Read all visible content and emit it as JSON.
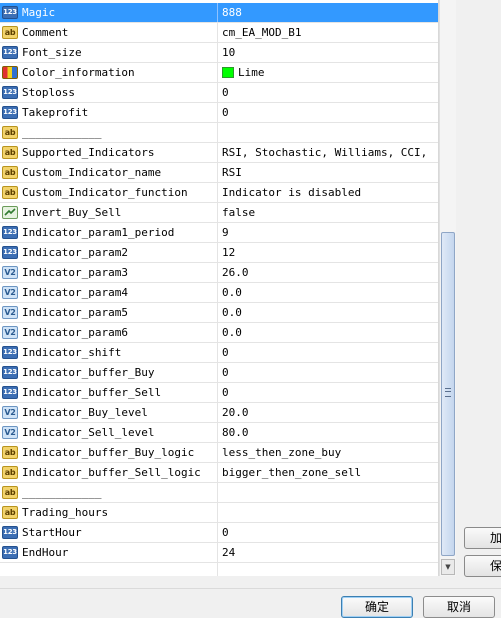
{
  "rows": [
    {
      "type": "int",
      "badge": "123",
      "name": "Magic",
      "value": "888"
    },
    {
      "type": "str",
      "badge": "ab",
      "name": "Comment",
      "value": "cm_EA_MOD_B1"
    },
    {
      "type": "int",
      "badge": "123",
      "name": "Font_size",
      "value": "10"
    },
    {
      "type": "color",
      "badge": "",
      "name": "Color_information",
      "value": "Lime"
    },
    {
      "type": "int",
      "badge": "123",
      "name": "Stoploss",
      "value": "0"
    },
    {
      "type": "int",
      "badge": "123",
      "name": "Takeprofit",
      "value": "0"
    },
    {
      "type": "str",
      "badge": "ab",
      "name": "____________",
      "value": ""
    },
    {
      "type": "str",
      "badge": "ab",
      "name": "Supported_Indicators",
      "value": "RSI, Stochastic, Williams, CCI, ..."
    },
    {
      "type": "str",
      "badge": "ab",
      "name": "Custom_Indicator_name",
      "value": "RSI"
    },
    {
      "type": "str",
      "badge": "ab",
      "name": "Custom_Indicator_function",
      "value": "Indicator is disabled"
    },
    {
      "type": "bool",
      "badge": "",
      "name": "Invert_Buy_Sell",
      "value": "false"
    },
    {
      "type": "int",
      "badge": "123",
      "name": "Indicator_param1_period",
      "value": "9"
    },
    {
      "type": "int",
      "badge": "123",
      "name": "Indicator_param2",
      "value": "12"
    },
    {
      "type": "dbl",
      "badge": "V2",
      "name": "Indicator_param3",
      "value": "26.0"
    },
    {
      "type": "dbl",
      "badge": "V2",
      "name": "Indicator_param4",
      "value": "0.0"
    },
    {
      "type": "dbl",
      "badge": "V2",
      "name": "Indicator_param5",
      "value": "0.0"
    },
    {
      "type": "dbl",
      "badge": "V2",
      "name": "Indicator_param6",
      "value": "0.0"
    },
    {
      "type": "int",
      "badge": "123",
      "name": "Indicator_shift",
      "value": "0"
    },
    {
      "type": "int",
      "badge": "123",
      "name": "Indicator_buffer_Buy",
      "value": "0"
    },
    {
      "type": "int",
      "badge": "123",
      "name": "Indicator_buffer_Sell",
      "value": "0"
    },
    {
      "type": "dbl",
      "badge": "V2",
      "name": "Indicator_Buy_level",
      "value": "20.0"
    },
    {
      "type": "dbl",
      "badge": "V2",
      "name": "Indicator_Sell_level",
      "value": "80.0"
    },
    {
      "type": "str",
      "badge": "ab",
      "name": "Indicator_buffer_Buy_logic",
      "value": "less_then_zone_buy"
    },
    {
      "type": "str",
      "badge": "ab",
      "name": "Indicator_buffer_Sell_logic",
      "value": "bigger_then_zone_sell"
    },
    {
      "type": "str",
      "badge": "ab",
      "name": "____________",
      "value": ""
    },
    {
      "type": "str",
      "badge": "ab",
      "name": "Trading_hours",
      "value": ""
    },
    {
      "type": "int",
      "badge": "123",
      "name": "StartHour",
      "value": "0"
    },
    {
      "type": "int",
      "badge": "123",
      "name": "EndHour",
      "value": "24"
    },
    {
      "type": "blank",
      "badge": "",
      "name": "",
      "value": ""
    }
  ],
  "selected_row": 0,
  "swatch_color": "#00ff00",
  "side_buttons": [
    "加",
    "保"
  ],
  "buttons": {
    "ok": "确定",
    "cancel": "取消"
  }
}
